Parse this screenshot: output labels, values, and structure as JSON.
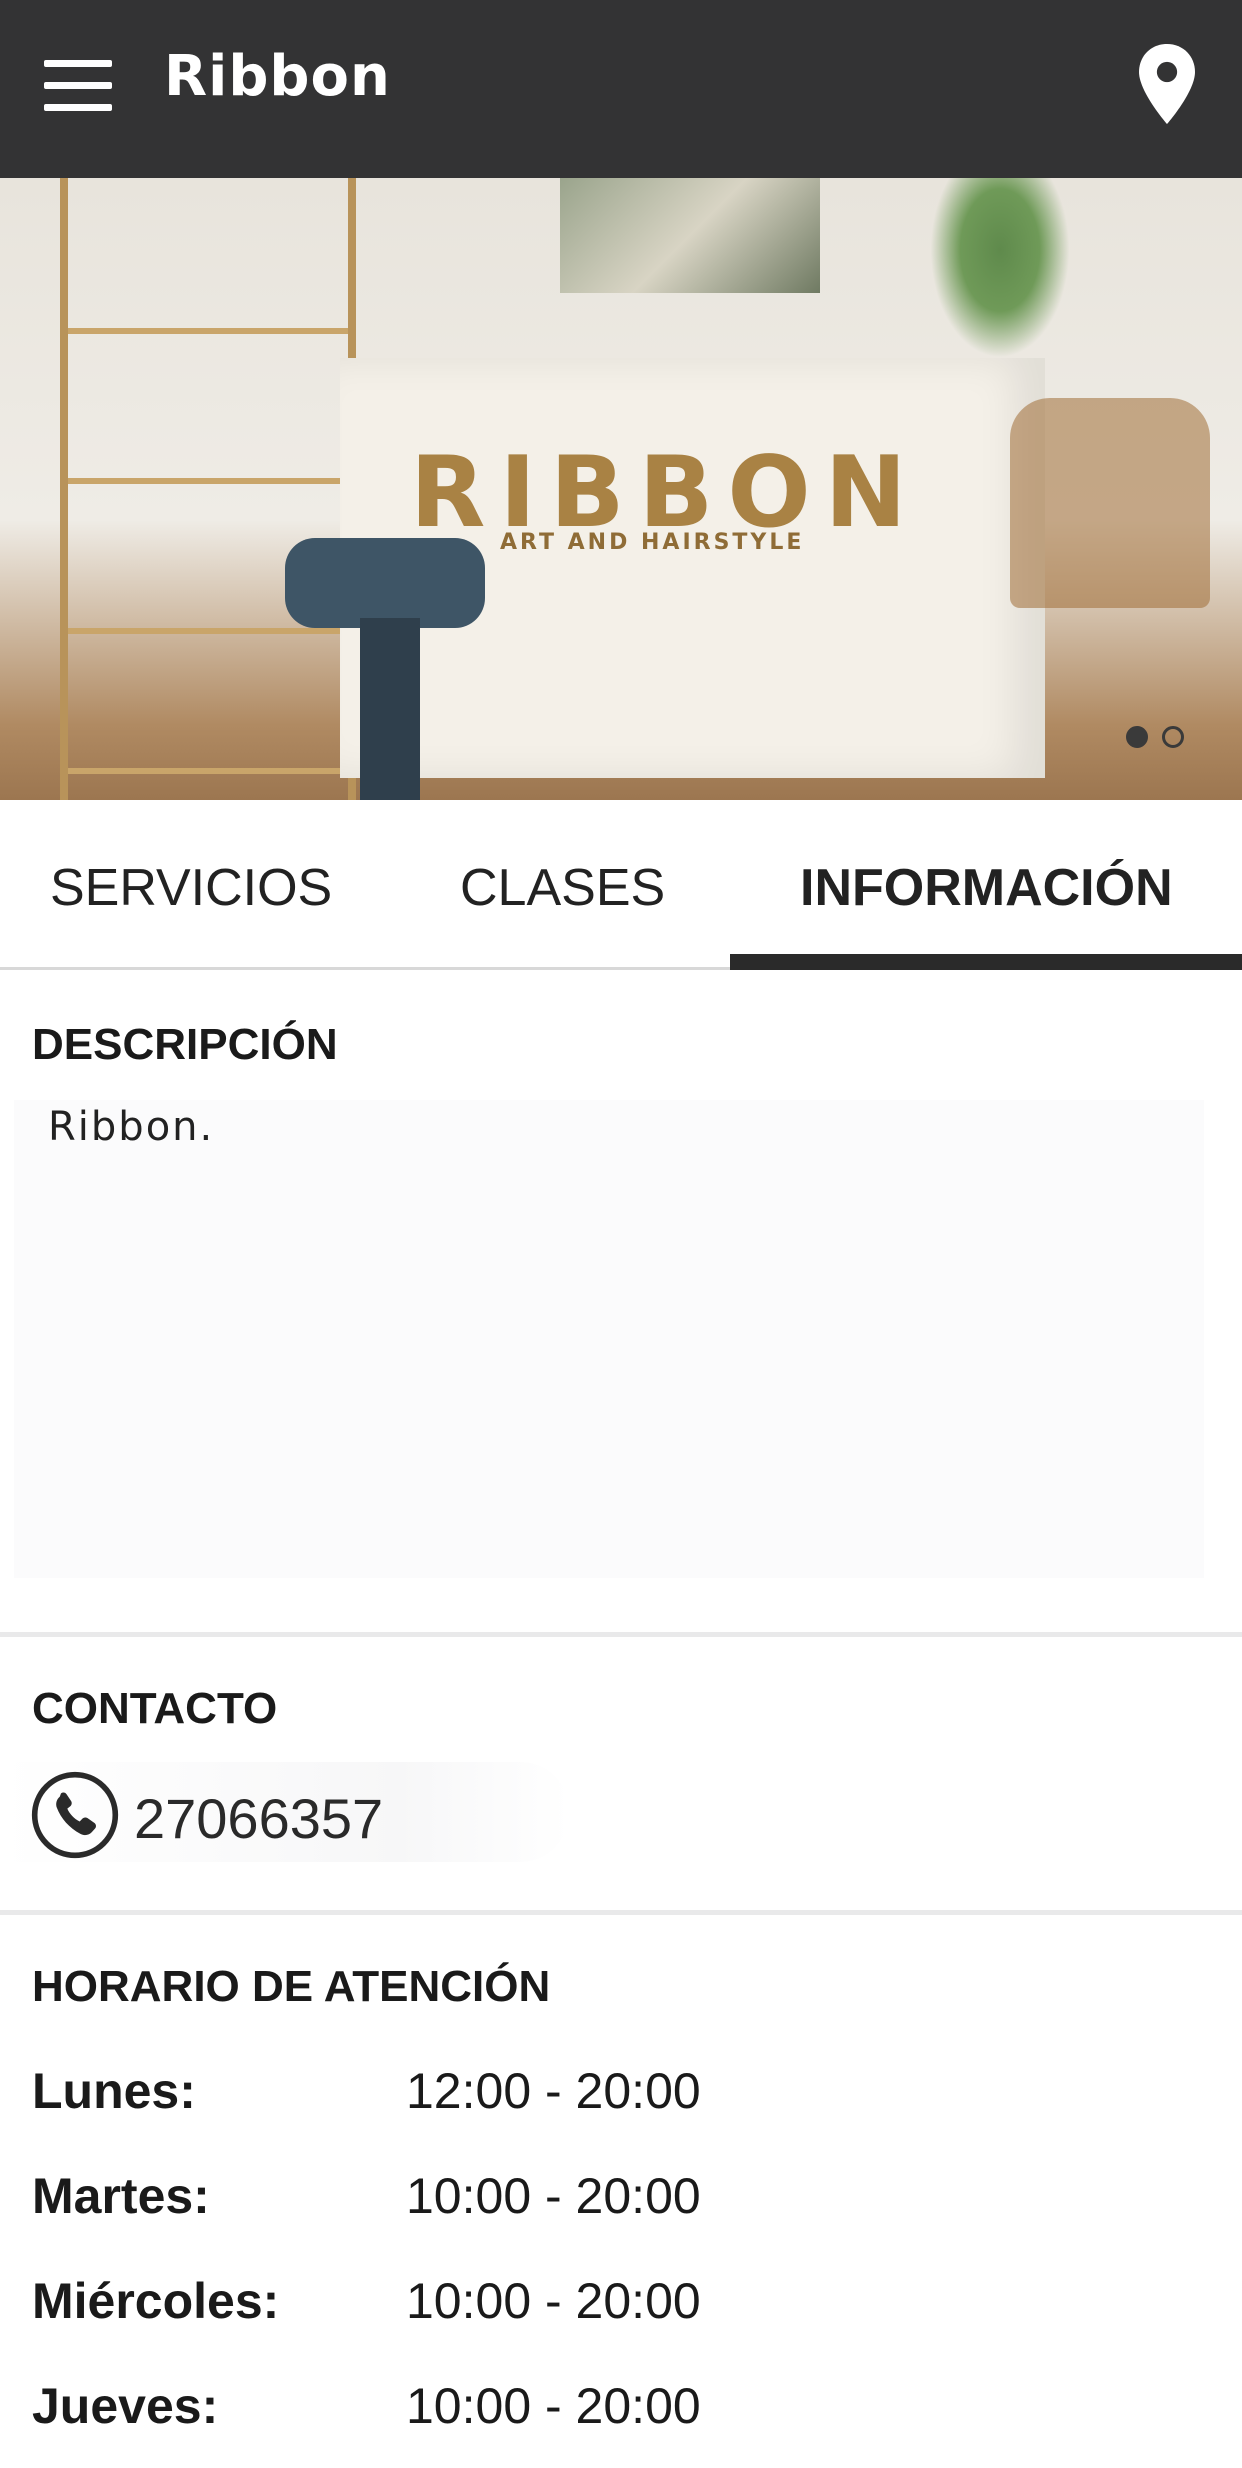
{
  "app_bar": {
    "title": "Ribbon",
    "menu_icon": "hamburger-menu-icon",
    "location_icon": "map-pin-icon",
    "background_color": "#333334"
  },
  "hero": {
    "logo_main": "RIBBON",
    "logo_sub": "ART AND HAIRSTYLE",
    "carousel_index": 1,
    "carousel_total": 2
  },
  "tabs": [
    {
      "label": "SERVICIOS",
      "active": false
    },
    {
      "label": "CLASES",
      "active": false
    },
    {
      "label": "INFORMACIÓN",
      "active": true
    }
  ],
  "description": {
    "title": "DESCRIPCIÓN",
    "text": "Ribbon."
  },
  "contact": {
    "title": "CONTACTO",
    "phone_icon": "phone-icon",
    "phone": "27066357"
  },
  "hours": {
    "title": "HORARIO DE ATENCIÓN",
    "rows": [
      {
        "day": "Lunes:",
        "time": "12:00 - 20:00"
      },
      {
        "day": "Martes:",
        "time": "10:00 - 20:00"
      },
      {
        "day": "Miércoles:",
        "time": "10:00 - 20:00"
      },
      {
        "day": "Jueves:",
        "time": "10:00 - 20:00"
      }
    ]
  }
}
